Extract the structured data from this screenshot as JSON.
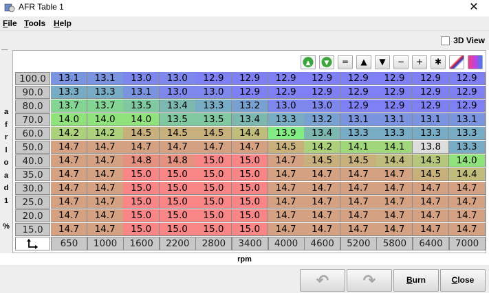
{
  "window": {
    "title": "AFR Table 1",
    "close_glyph": "✕"
  },
  "menu": [
    {
      "label": "File",
      "mnemonic": "F",
      "rest": "ile"
    },
    {
      "label": "Tools",
      "mnemonic": "T",
      "rest": "ools"
    },
    {
      "label": "Help",
      "mnemonic": "H",
      "rest": "elp"
    }
  ],
  "view3d": {
    "label": "3D View",
    "mnemonic": "D",
    "checked": false
  },
  "toolbar": [
    {
      "name": "increment-green-icon",
      "glyph": "▲"
    },
    {
      "name": "decrement-green-icon",
      "glyph": "▼"
    },
    {
      "name": "set-equal-button",
      "glyph": "="
    },
    {
      "name": "increase-button",
      "glyph": "▲"
    },
    {
      "name": "decrease-button",
      "glyph": "▼"
    },
    {
      "name": "subtract-button",
      "glyph": "−"
    },
    {
      "name": "add-button",
      "glyph": "+"
    },
    {
      "name": "multiply-button",
      "glyph": "✱"
    },
    {
      "name": "interpolate-icon",
      "glyph": "⁄"
    },
    {
      "name": "color-scale-icon",
      "glyph": "▮"
    }
  ],
  "y_axis": {
    "label_chars": [
      "a",
      "f",
      "r",
      "l",
      "o",
      "a",
      "d",
      "1",
      "",
      "%"
    ]
  },
  "x_axis": {
    "label": "rpm"
  },
  "rows": [
    "100.0",
    "90.0",
    "80.0",
    "70.0",
    "60.0",
    "50.0",
    "40.0",
    "35.0",
    "30.0",
    "25.0",
    "20.0",
    "15.0"
  ],
  "cols": [
    "650",
    "1000",
    "1600",
    "2200",
    "2800",
    "3400",
    "4000",
    "4600",
    "5200",
    "5800",
    "6400",
    "7000"
  ],
  "table": [
    [
      "13.1",
      "13.1",
      "13.0",
      "13.0",
      "12.9",
      "12.9",
      "12.9",
      "12.9",
      "12.9",
      "12.9",
      "12.9",
      "12.9"
    ],
    [
      "13.3",
      "13.3",
      "13.1",
      "13.0",
      "13.0",
      "12.9",
      "12.9",
      "12.9",
      "12.9",
      "12.9",
      "12.9",
      "12.9"
    ],
    [
      "13.7",
      "13.7",
      "13.5",
      "13.4",
      "13.3",
      "13.2",
      "13.0",
      "13.0",
      "12.9",
      "12.9",
      "12.9",
      "12.9"
    ],
    [
      "14.0",
      "14.0",
      "14.0",
      "13.5",
      "13.5",
      "13.4",
      "13.3",
      "13.2",
      "13.1",
      "13.1",
      "13.1",
      "13.1"
    ],
    [
      "14.2",
      "14.2",
      "14.5",
      "14.5",
      "14.5",
      "14.4",
      "13.9",
      "13.4",
      "13.3",
      "13.3",
      "13.3",
      "13.3"
    ],
    [
      "14.7",
      "14.7",
      "14.7",
      "14.7",
      "14.7",
      "14.7",
      "14.5",
      "14.2",
      "14.1",
      "14.1",
      "13.8",
      "13.3"
    ],
    [
      "14.7",
      "14.7",
      "14.8",
      "14.8",
      "15.0",
      "15.0",
      "14.7",
      "14.5",
      "14.5",
      "14.4",
      "14.3",
      "14.0"
    ],
    [
      "14.7",
      "14.7",
      "15.0",
      "15.0",
      "15.0",
      "15.0",
      "14.7",
      "14.7",
      "14.7",
      "14.7",
      "14.5",
      "14.4"
    ],
    [
      "14.7",
      "14.7",
      "15.0",
      "15.0",
      "15.0",
      "15.0",
      "14.7",
      "14.7",
      "14.7",
      "14.7",
      "14.7",
      "14.7"
    ],
    [
      "14.7",
      "14.7",
      "15.0",
      "15.0",
      "15.0",
      "15.0",
      "14.7",
      "14.7",
      "14.7",
      "14.7",
      "14.7",
      "14.7"
    ],
    [
      "14.7",
      "14.7",
      "15.0",
      "15.0",
      "15.0",
      "15.0",
      "14.7",
      "14.7",
      "14.7",
      "14.7",
      "14.7",
      "14.7"
    ],
    [
      "14.7",
      "14.7",
      "15.0",
      "15.0",
      "15.0",
      "15.0",
      "14.7",
      "14.7",
      "14.7",
      "14.7",
      "14.7",
      "14.7"
    ]
  ],
  "buttons": {
    "undo_icon": "↶",
    "redo_icon": "↷",
    "burn": {
      "label": "Burn",
      "mnemonic": "B",
      "rest": "urn"
    },
    "close": {
      "label": "Close",
      "mnemonic": "C",
      "rest": "lose"
    }
  },
  "colors": {
    "c12_9": "#8080f5",
    "c13_0": "#7e88ec",
    "c13_1": "#7a94e0",
    "c13_2": "#78a0d0",
    "c13_3": "#78acc4",
    "c13_4": "#7cb8b0",
    "c13_5": "#80c8a0",
    "c13_7": "#84d494",
    "c13_9": "#84ec84",
    "c14_0": "#90e27c",
    "c14_1": "#a0d67c",
    "c14_2": "#acd07c",
    "c14_3": "#b6c67c",
    "c14_4": "#c0bc7c",
    "c14_5": "#c8b07c",
    "c14_7": "#d4a282",
    "c14_8": "#e69080",
    "c15_0": "#f98686"
  }
}
